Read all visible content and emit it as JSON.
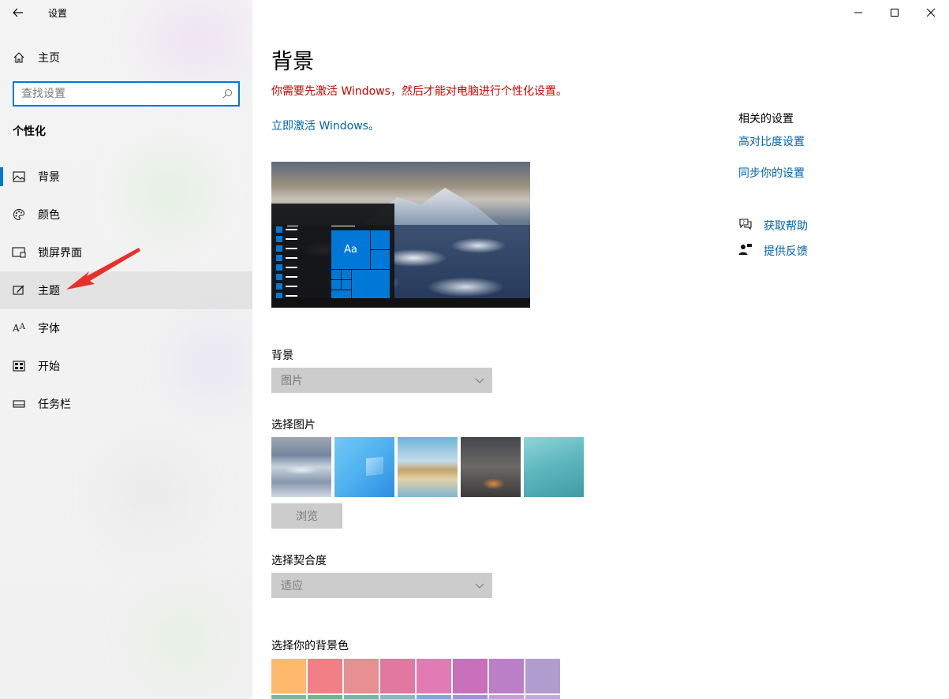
{
  "window": {
    "app_title": "设置",
    "back_icon": "back-arrow-icon",
    "minimize_glyph": "—",
    "maximize_glyph": "☐",
    "close_glyph": "✕"
  },
  "sidebar": {
    "home_label": "主页",
    "search_placeholder": "查找设置",
    "section_title": "个性化",
    "items": [
      {
        "label": "背景",
        "icon": "picture-icon"
      },
      {
        "label": "颜色",
        "icon": "palette-icon"
      },
      {
        "label": "锁屏界面",
        "icon": "lock-screen-icon"
      },
      {
        "label": "主题",
        "icon": "brush-icon"
      },
      {
        "label": "字体",
        "icon": "font-icon"
      },
      {
        "label": "开始",
        "icon": "start-icon"
      },
      {
        "label": "任务栏",
        "icon": "taskbar-icon"
      }
    ]
  },
  "main": {
    "title": "背景",
    "warning": "你需要先激活 Windows，然后才能对电脑进行个性化设置。",
    "activate_link": "立即激活 Windows。",
    "preview_tile_text": "Aa",
    "background_label": "背景",
    "background_value": "图片",
    "choose_picture_label": "选择图片",
    "browse_label": "浏览",
    "fit_label": "选择契合度",
    "fit_value": "适应",
    "bgcolor_label": "选择你的背景色",
    "swatches": [
      "#ffb86c",
      "#f27f86",
      "#e69091",
      "#e0789f",
      "#e07bb6",
      "#c96fbb",
      "#bb7fc8",
      "#b09ccf",
      "#7fb69a",
      "#6fb48a",
      "#7ab3a6",
      "#8ab6c4",
      "#7fa7d4",
      "#9b93d4",
      "#c59ed6",
      "#bfa9d8"
    ]
  },
  "related": {
    "title": "相关的设置",
    "links": [
      "高对比度设置",
      "同步你的设置"
    ],
    "help": "获取帮助",
    "feedback": "提供反馈"
  },
  "colors": {
    "accent": "#0078d7",
    "link": "#0063b1",
    "warning": "#c50500"
  }
}
